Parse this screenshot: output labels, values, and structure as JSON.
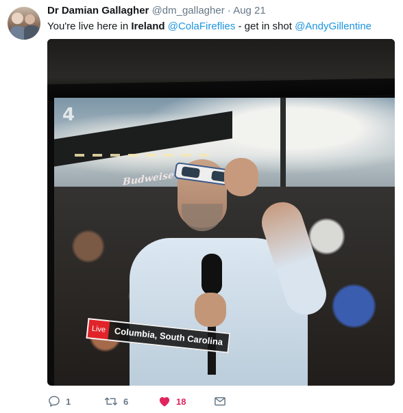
{
  "tweet": {
    "author_name": "Dr Damian Gallagher",
    "author_handle": "@dm_gallagher",
    "separator": "·",
    "date": "Aug 21",
    "text_parts": {
      "p1": "You're live here in ",
      "p2_bold": "Ireland",
      "p3": " ",
      "mention1": "@ColaFireflies",
      "p4": " - get in shot ",
      "mention2": "@AndyGillentine"
    }
  },
  "media": {
    "channel_logo": "4",
    "stadium_sign": "Budweiser",
    "live_label": "Live",
    "location_label": "Columbia, South Carolina"
  },
  "actions": {
    "reply_icon": "reply-icon",
    "reply_count": "1",
    "retweet_icon": "retweet-icon",
    "retweet_count": "6",
    "like_icon": "heart-icon",
    "like_count": "18",
    "dm_icon": "envelope-icon"
  },
  "colors": {
    "link": "#1b95e0",
    "like": "#e0245e",
    "muted": "#657786",
    "live_red": "#e0242a"
  }
}
